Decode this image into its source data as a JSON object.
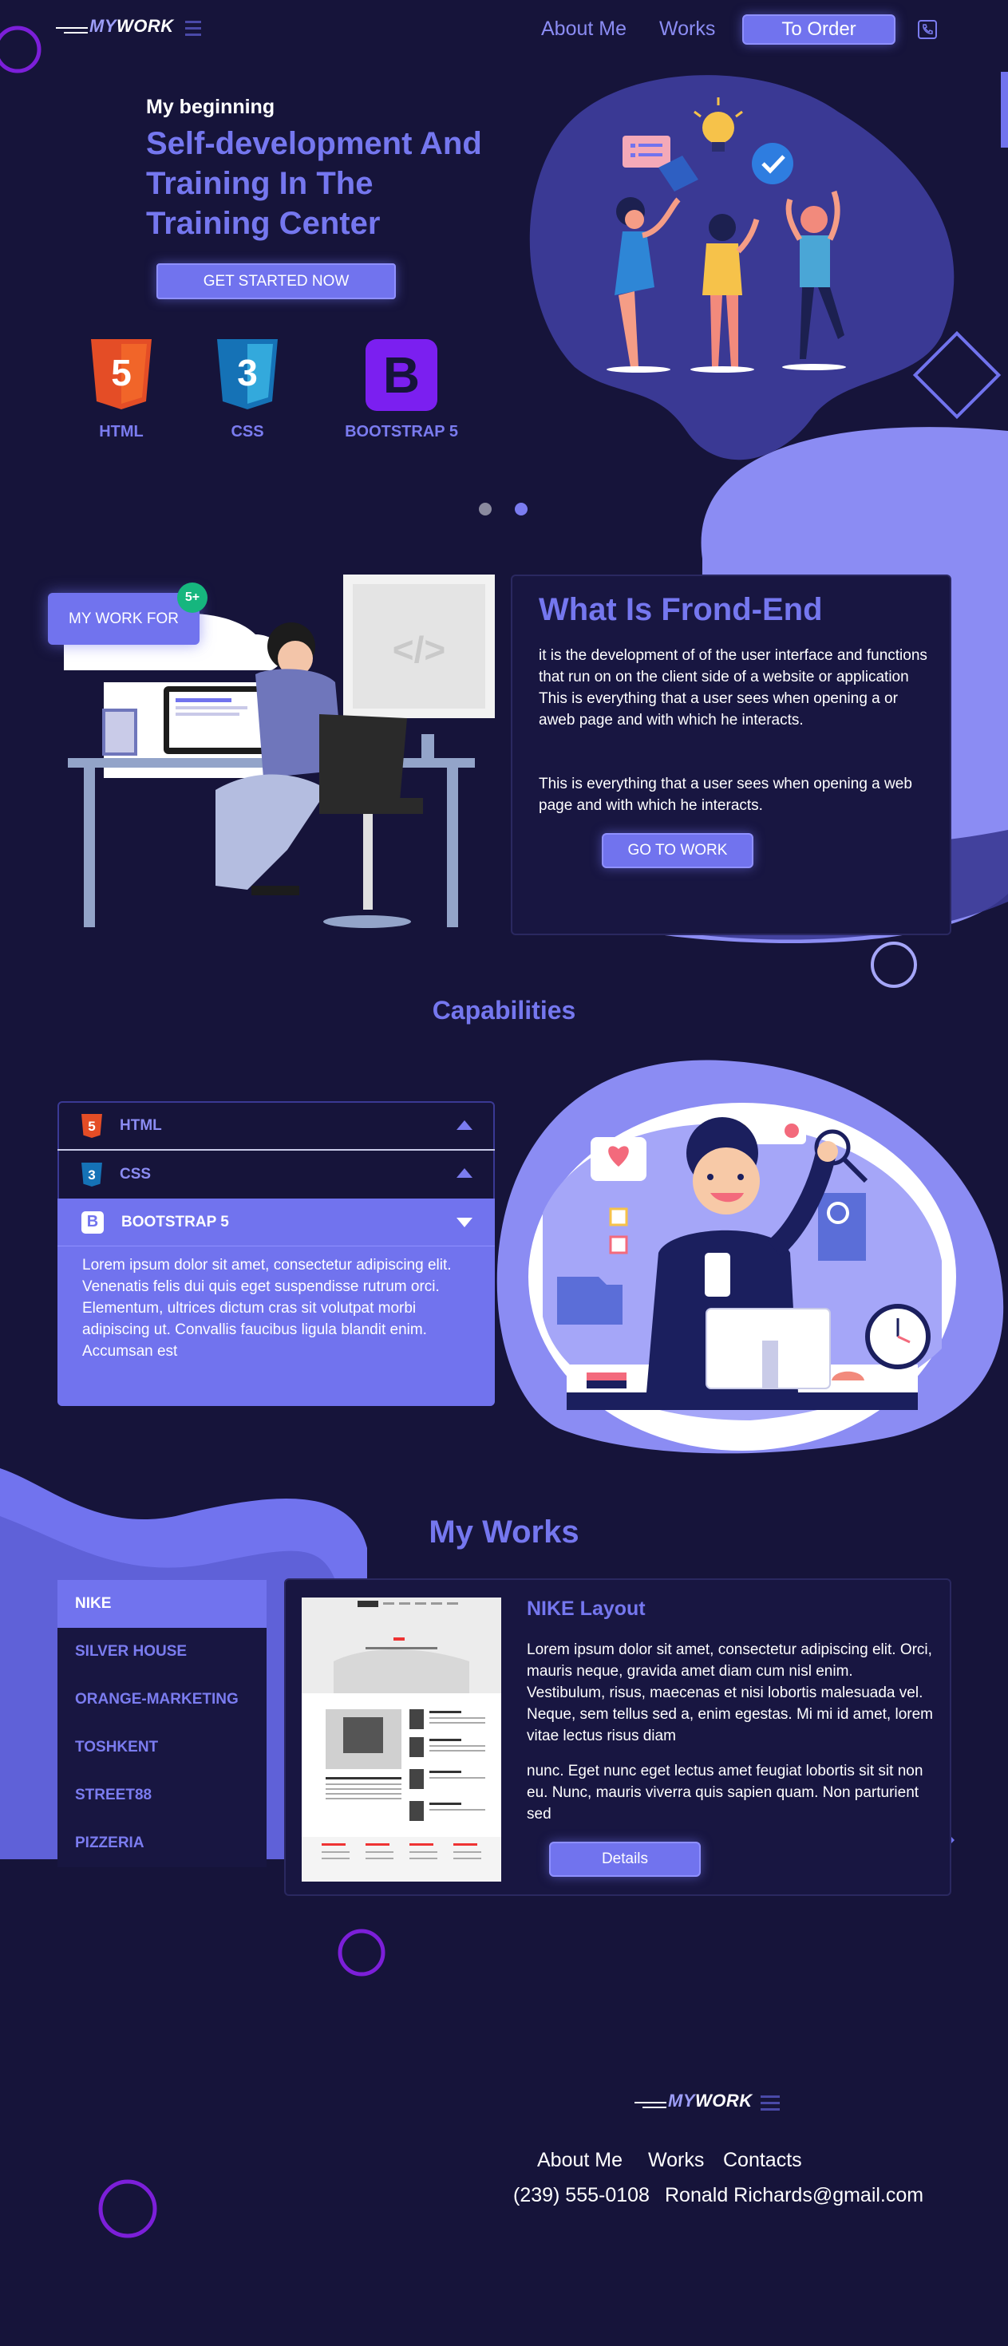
{
  "colors": {
    "background": "#16143a",
    "accent": "#7173ee",
    "accent_light": "#9d9ef8"
  },
  "header": {
    "logo_prefix": "MY",
    "logo_suffix": "WORK",
    "nav": {
      "about": "About Me",
      "works": "Works"
    },
    "order_button": "To Order",
    "phone_icon": "phone-icon"
  },
  "hero": {
    "subtitle": "My beginning",
    "title": "Self-development And Training In The Training Center",
    "cta": "GET STARTED NOW",
    "techs": [
      {
        "icon": "html5-icon",
        "glyph": "5",
        "label": "HTML"
      },
      {
        "icon": "css3-icon",
        "glyph": "3",
        "label": "CSS"
      },
      {
        "icon": "bootstrap-icon",
        "glyph": "B",
        "label": "BOOTSTRAP 5"
      }
    ]
  },
  "frontend": {
    "badge_label": "MY WORK FOR",
    "badge_count": "5+",
    "code_glyph": "</>",
    "title": "What Is Frond-End",
    "paragraph1": "it is the development of of the user interface and functions that run on on the client side of a website or application This is everything that a user sees when opening a or aweb page and with which he interacts.",
    "paragraph2": "This is everything that a user sees when opening a web page and with which he interacts.",
    "cta": "GO TO WORK"
  },
  "capabilities": {
    "title": "Capabilities",
    "items": [
      {
        "icon": "html5-icon",
        "glyph": "5",
        "label": "HTML",
        "expanded": false
      },
      {
        "icon": "css3-icon",
        "glyph": "3",
        "label": "CSS",
        "expanded": false
      },
      {
        "icon": "bootstrap-icon",
        "glyph": "B",
        "label": "BOOTSTRAP 5",
        "expanded": true
      }
    ],
    "expanded_text": "Lorem ipsum dolor sit amet, consectetur adipiscing elit. Venenatis felis dui quis eget suspendisse rutrum orci. Elementum, ultrices dictum cras sit volutpat morbi adipiscing ut. Convallis faucibus ligula blandit enim. Accumsan est"
  },
  "works": {
    "title": "My Works",
    "items": [
      "NIKE",
      "SILVER HOUSE",
      "ORANGE-MARKETING",
      "TOSHKENT",
      "STREET88",
      "PIZZERIA"
    ],
    "active_index": 0,
    "project_title": "NIKE Layout",
    "paragraph1": "Lorem ipsum dolor sit amet, consectetur adipiscing elit. Orci, mauris neque, gravida amet diam cum nisl enim. Vestibulum, risus, maecenas et nisi lobortis malesuada vel. Neque, sem tellus sed a, enim egestas. Mi mi id amet, lorem vitae lectus risus diam",
    "paragraph2": "nunc. Eget nunc eget lectus amet feugiat lobortis sit sit non eu. Nunc, mauris viverra quis sapien quam. Non parturient sed",
    "details_button": "Details"
  },
  "footer": {
    "logo_prefix": "MY",
    "logo_suffix": "WORK",
    "links": [
      "About Me",
      "Works",
      "Contacts"
    ],
    "phone": "(239) 555-0108",
    "email": "Ronald Richards@gmail.com"
  }
}
